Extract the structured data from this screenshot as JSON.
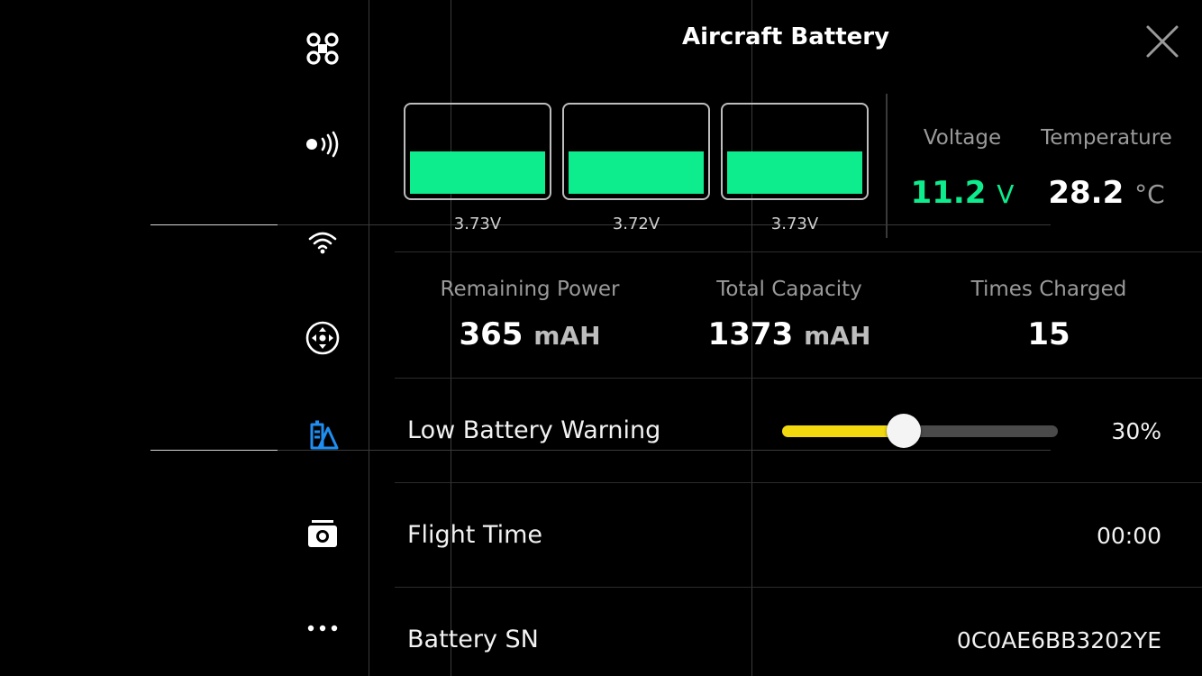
{
  "sidebar": {
    "items": [
      {
        "icon": "aircraft-icon"
      },
      {
        "icon": "signal-icon"
      },
      {
        "icon": "wifi-icon"
      },
      {
        "icon": "gimbal-control-icon"
      },
      {
        "icon": "battery-settings-icon",
        "active": true
      },
      {
        "icon": "camera-icon"
      },
      {
        "icon": "more-icon"
      }
    ]
  },
  "header": {
    "title": "Aircraft Battery"
  },
  "cells": [
    {
      "voltage": "3.73V",
      "level": 0.5
    },
    {
      "voltage": "3.72V",
      "level": 0.5
    },
    {
      "voltage": "3.73V",
      "level": 0.5
    }
  ],
  "voltage": {
    "label": "Voltage",
    "value": "11.2",
    "unit": "V"
  },
  "temperature": {
    "label": "Temperature",
    "value": "28.2",
    "unit": "°C"
  },
  "stats": {
    "remaining": {
      "label": "Remaining Power",
      "value": "365",
      "unit": "mAH"
    },
    "capacity": {
      "label": "Total Capacity",
      "value": "1373",
      "unit": "mAH"
    },
    "charged": {
      "label": "Times Charged",
      "value": "15"
    }
  },
  "low_battery": {
    "label": "Low Battery Warning",
    "value": "30%",
    "fraction": 0.44
  },
  "flight_time": {
    "label": "Flight Time",
    "value": "00:00"
  },
  "battery_sn": {
    "label": "Battery SN",
    "value": "0C0AE6BB3202YE"
  },
  "colors": {
    "accent_green": "#0ded8d",
    "slider_yellow": "#f2d80f",
    "active_blue": "#1f8ef1"
  }
}
